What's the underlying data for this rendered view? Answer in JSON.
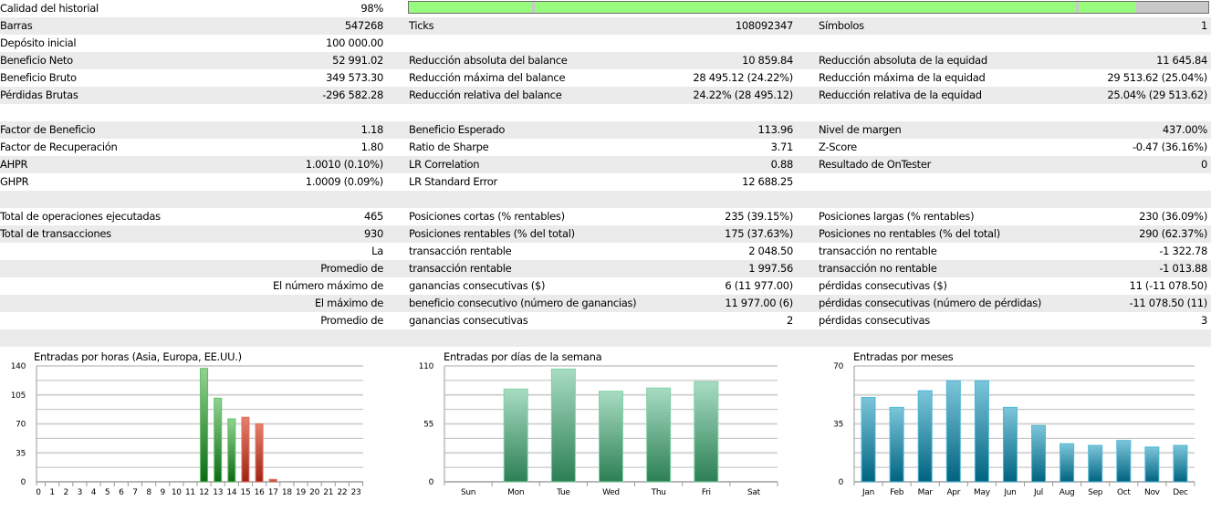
{
  "history_quality": {
    "label": "Calidad del historial",
    "value": "98%",
    "fill_percent": 91,
    "bar_color": "#98fb7e"
  },
  "rows": [
    [
      "Barras",
      "547268",
      "Ticks",
      "108092347",
      "Símbolos",
      "1"
    ],
    [
      "Depósito inicial",
      "100 000.00",
      "",
      "",
      "",
      ""
    ],
    [
      "Beneficio Neto",
      "52 991.02",
      "Reducción absoluta del balance",
      "10 859.84",
      "Reducción absoluta de la equidad",
      "11 645.84"
    ],
    [
      "Beneficio Bruto",
      "349 573.30",
      "Reducción máxima del balance",
      "28 495.12 (24.22%)",
      "Reducción máxima de la equidad",
      "29 513.62 (25.04%)"
    ],
    [
      "Pérdidas Brutas",
      "-296 582.28",
      "Reducción relativa del balance",
      "24.22% (28 495.12)",
      "Reducción relativa de la equidad",
      "25.04% (29 513.62)"
    ],
    [
      "",
      "",
      "",
      "",
      "",
      ""
    ],
    [
      "Factor de Beneficio",
      "1.18",
      "Beneficio Esperado",
      "113.96",
      "Nivel de margen",
      "437.00%"
    ],
    [
      "Factor de Recuperación",
      "1.80",
      "Ratio de Sharpe",
      "3.71",
      "Z-Score",
      "-0.47 (36.16%)"
    ],
    [
      "AHPR",
      "1.0010 (0.10%)",
      "LR Correlation",
      "0.88",
      "Resultado de OnTester",
      "0"
    ],
    [
      "GHPR",
      "1.0009 (0.09%)",
      "LR Standard Error",
      "12 688.25",
      "",
      ""
    ],
    [
      "",
      "",
      "",
      "",
      "",
      ""
    ],
    [
      "Total de operaciones ejecutadas",
      "465",
      "Posiciones cortas (% rentables)",
      "235 (39.15%)",
      "Posiciones largas (% rentables)",
      "230 (36.09%)"
    ],
    [
      "Total de transacciones",
      "930",
      "Posiciones rentables (% del total)",
      "175 (37.63%)",
      "Posiciones no rentables (% del total)",
      "290 (62.37%)"
    ],
    [
      "",
      "La",
      "transacción rentable",
      "2 048.50",
      "transacción no rentable",
      "-1 322.78"
    ],
    [
      "",
      "Promedio de",
      "transacción rentable",
      "1 997.56",
      "transacción no rentable",
      "-1 013.88"
    ],
    [
      "",
      "El número máximo de",
      "ganancias consecutivas ($)",
      "6 (11 977.00)",
      "pérdidas consecutivas ($)",
      "11 (-11 078.50)"
    ],
    [
      "",
      "El máximo de",
      "beneficio consecutivo (número de ganancias)",
      "11 977.00 (6)",
      "pérdidas consecutivas (número de pérdidas)",
      "-11 078.50 (11)"
    ],
    [
      "",
      "Promedio de",
      "ganancias consecutivas",
      "2",
      "pérdidas consecutivas",
      "3"
    ],
    [
      "",
      "",
      "",
      "",
      "",
      ""
    ]
  ],
  "chart_data": [
    {
      "type": "bar",
      "title": "Entradas por horas (Asia, Europa, EE.UU.)",
      "categories": [
        "0",
        "1",
        "2",
        "3",
        "4",
        "5",
        "6",
        "7",
        "8",
        "9",
        "10",
        "11",
        "12",
        "13",
        "14",
        "15",
        "16",
        "17",
        "18",
        "19",
        "20",
        "21",
        "22",
        "23"
      ],
      "values": [
        0,
        0,
        0,
        0,
        0,
        0,
        0,
        0,
        0,
        0,
        0,
        0,
        137,
        101,
        76,
        78,
        70,
        3,
        0,
        0,
        0,
        0,
        0,
        0
      ],
      "bar_colors": [
        "green",
        "green",
        "green",
        "green",
        "green",
        "green",
        "green",
        "green",
        "green",
        "green",
        "green",
        "green",
        "green",
        "green",
        "green",
        "red",
        "red",
        "red",
        "red",
        "red",
        "red",
        "red",
        "red",
        "red"
      ],
      "yticks": [
        0,
        35,
        70,
        105,
        140
      ],
      "ylim": [
        0,
        140
      ],
      "grid": true
    },
    {
      "type": "bar",
      "title": "Entradas por días de la semana",
      "categories": [
        "Sun",
        "Mon",
        "Tue",
        "Wed",
        "Thu",
        "Fri",
        "Sat"
      ],
      "values": [
        0,
        88,
        107,
        86,
        89,
        95,
        0
      ],
      "yticks": [
        0,
        55,
        110
      ],
      "ylim": [
        0,
        110
      ],
      "grid": true,
      "color": "#2e8158"
    },
    {
      "type": "bar",
      "title": "Entradas por meses",
      "categories": [
        "Jan",
        "Feb",
        "Mar",
        "Apr",
        "May",
        "Jun",
        "Jul",
        "Aug",
        "Sep",
        "Oct",
        "Nov",
        "Dec"
      ],
      "values": [
        51,
        45,
        55,
        61,
        61,
        45,
        34,
        23,
        22,
        25,
        21,
        22
      ],
      "yticks": [
        0,
        35,
        70
      ],
      "ylim": [
        0,
        70
      ],
      "grid": true,
      "color": "#006582"
    }
  ]
}
